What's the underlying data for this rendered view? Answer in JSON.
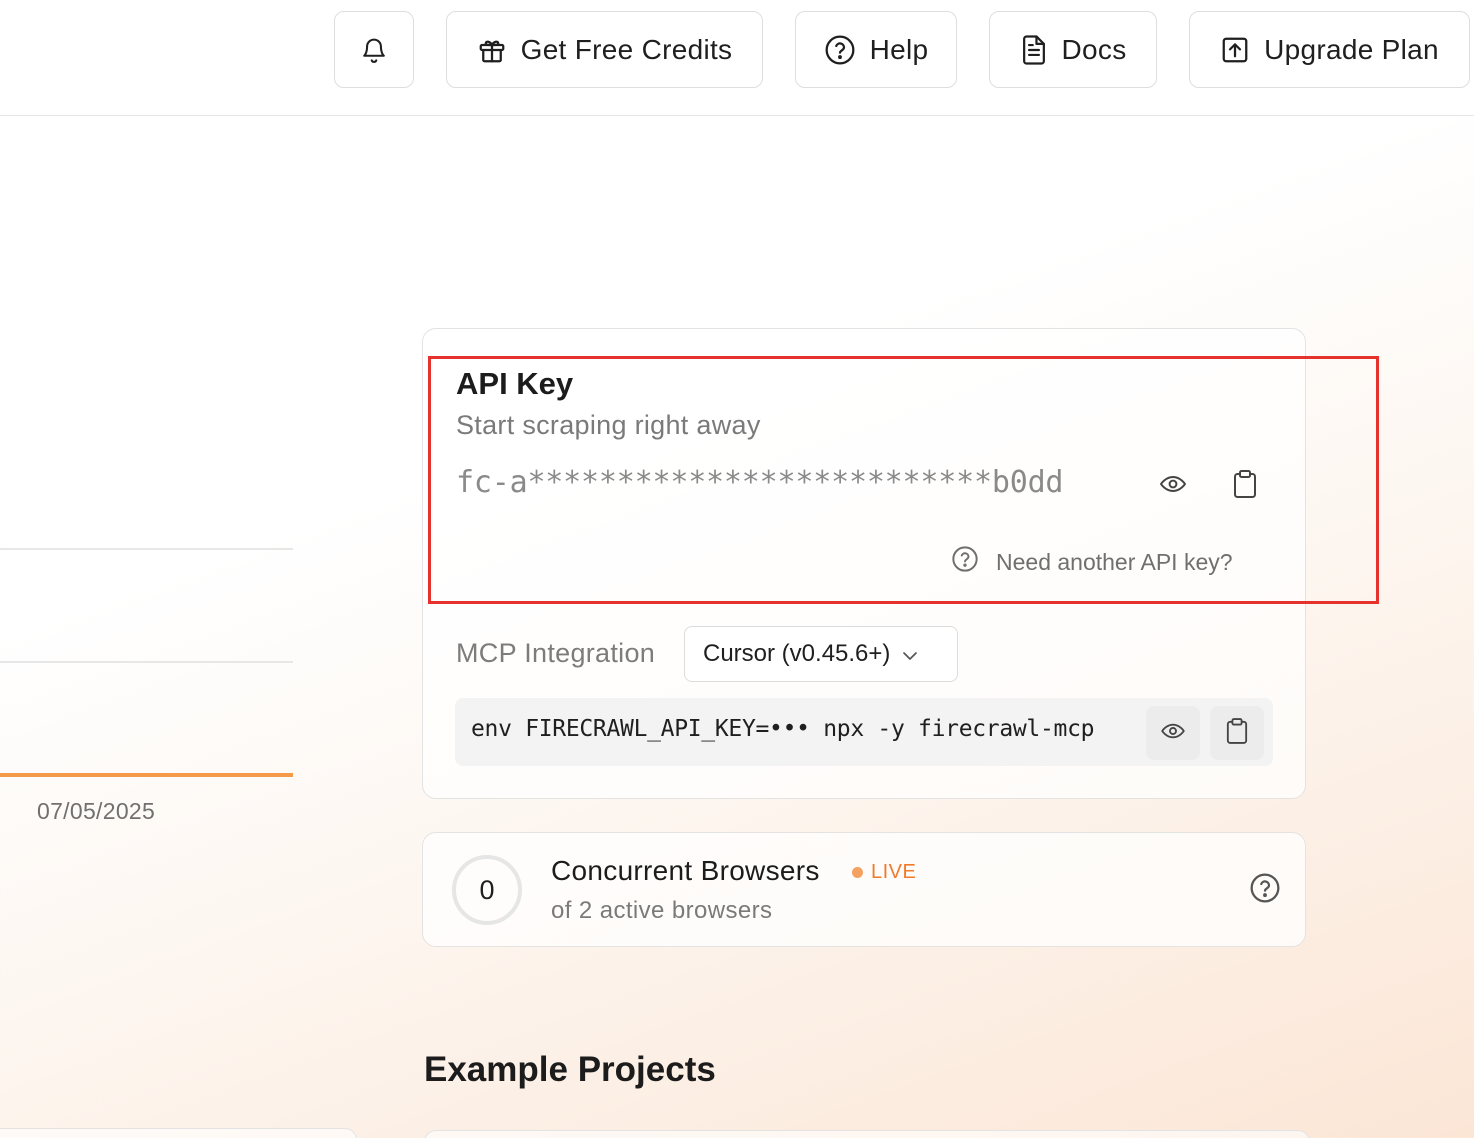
{
  "topbar": {
    "notifications_icon": "bell-icon",
    "credits_label": "Get Free Credits",
    "help_label": "Help",
    "docs_label": "Docs",
    "upgrade_label": "Upgrade Plan"
  },
  "left": {
    "date": "07/05/2025"
  },
  "api_key": {
    "title": "API Key",
    "subtitle": "Start scraping right away",
    "masked_key": "fc-a**************************b0dd",
    "need_another": "Need another API key?"
  },
  "mcp": {
    "label": "MCP Integration",
    "selected_client": "Cursor (v0.45.6+)",
    "command": "env FIRECRAWL_API_KEY=••• npx -y firecrawl-mcp"
  },
  "browsers": {
    "count": "0",
    "title": "Concurrent Browsers",
    "live_badge": "LIVE",
    "subtitle": "of 2 active browsers"
  },
  "examples": {
    "title": "Example Projects"
  },
  "colors": {
    "accent": "#f07a2c",
    "highlight_border": "#e5322d"
  }
}
